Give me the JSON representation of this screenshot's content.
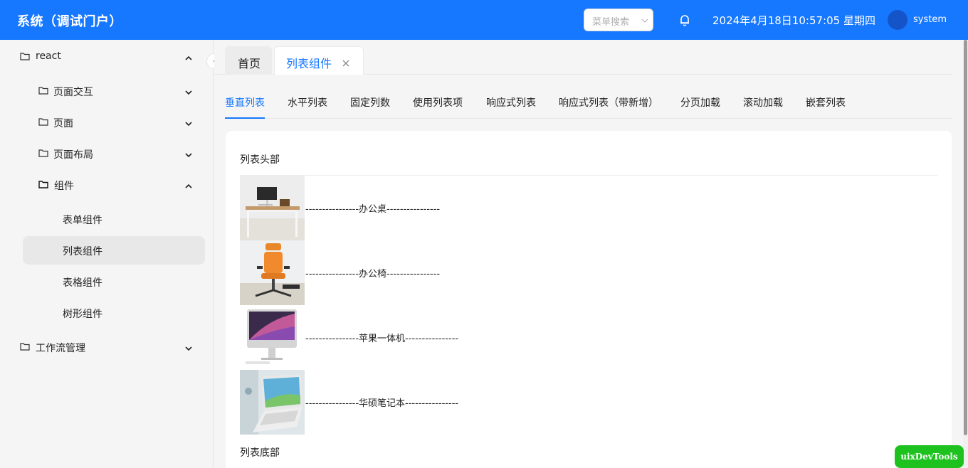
{
  "header": {
    "title": "系统（调试门户）",
    "search_placeholder": "菜单搜索",
    "datetime": "2024年4月18日10:57:05 星期四",
    "username": "system"
  },
  "sidebar": {
    "items": [
      {
        "label": "react",
        "expanded": true
      },
      {
        "label": "页面交互",
        "expanded": false
      },
      {
        "label": "页面",
        "expanded": false
      },
      {
        "label": "页面布局",
        "expanded": false
      },
      {
        "label": "组件",
        "expanded": true
      },
      {
        "label": "表单组件"
      },
      {
        "label": "列表组件",
        "active": true
      },
      {
        "label": "表格组件"
      },
      {
        "label": "树形组件"
      },
      {
        "label": "工作流管理",
        "expanded": false
      }
    ]
  },
  "page_tabs": [
    {
      "label": "首页"
    },
    {
      "label": "列表组件",
      "active": true
    }
  ],
  "sub_tabs": [
    {
      "label": "垂直列表",
      "active": true
    },
    {
      "label": "水平列表"
    },
    {
      "label": "固定列数"
    },
    {
      "label": "使用列表项"
    },
    {
      "label": "响应式列表"
    },
    {
      "label": "响应式列表（带新增）"
    },
    {
      "label": "分页加载"
    },
    {
      "label": "滚动加载"
    },
    {
      "label": "嵌套列表"
    }
  ],
  "list": {
    "header": "列表头部",
    "footer": "列表底部",
    "items": [
      {
        "text": "----------------办公桌----------------",
        "image": "desk-photo"
      },
      {
        "text": "----------------办公椅----------------",
        "image": "chair-photo"
      },
      {
        "text": "----------------苹果一体机----------------",
        "image": "imac-photo"
      },
      {
        "text": "----------------华硕笔记本----------------",
        "image": "laptop-photo"
      }
    ]
  },
  "devtools": {
    "label": "uixDevTools"
  },
  "colors": {
    "primary": "#1677ff",
    "devtools": "#1ec21e"
  }
}
